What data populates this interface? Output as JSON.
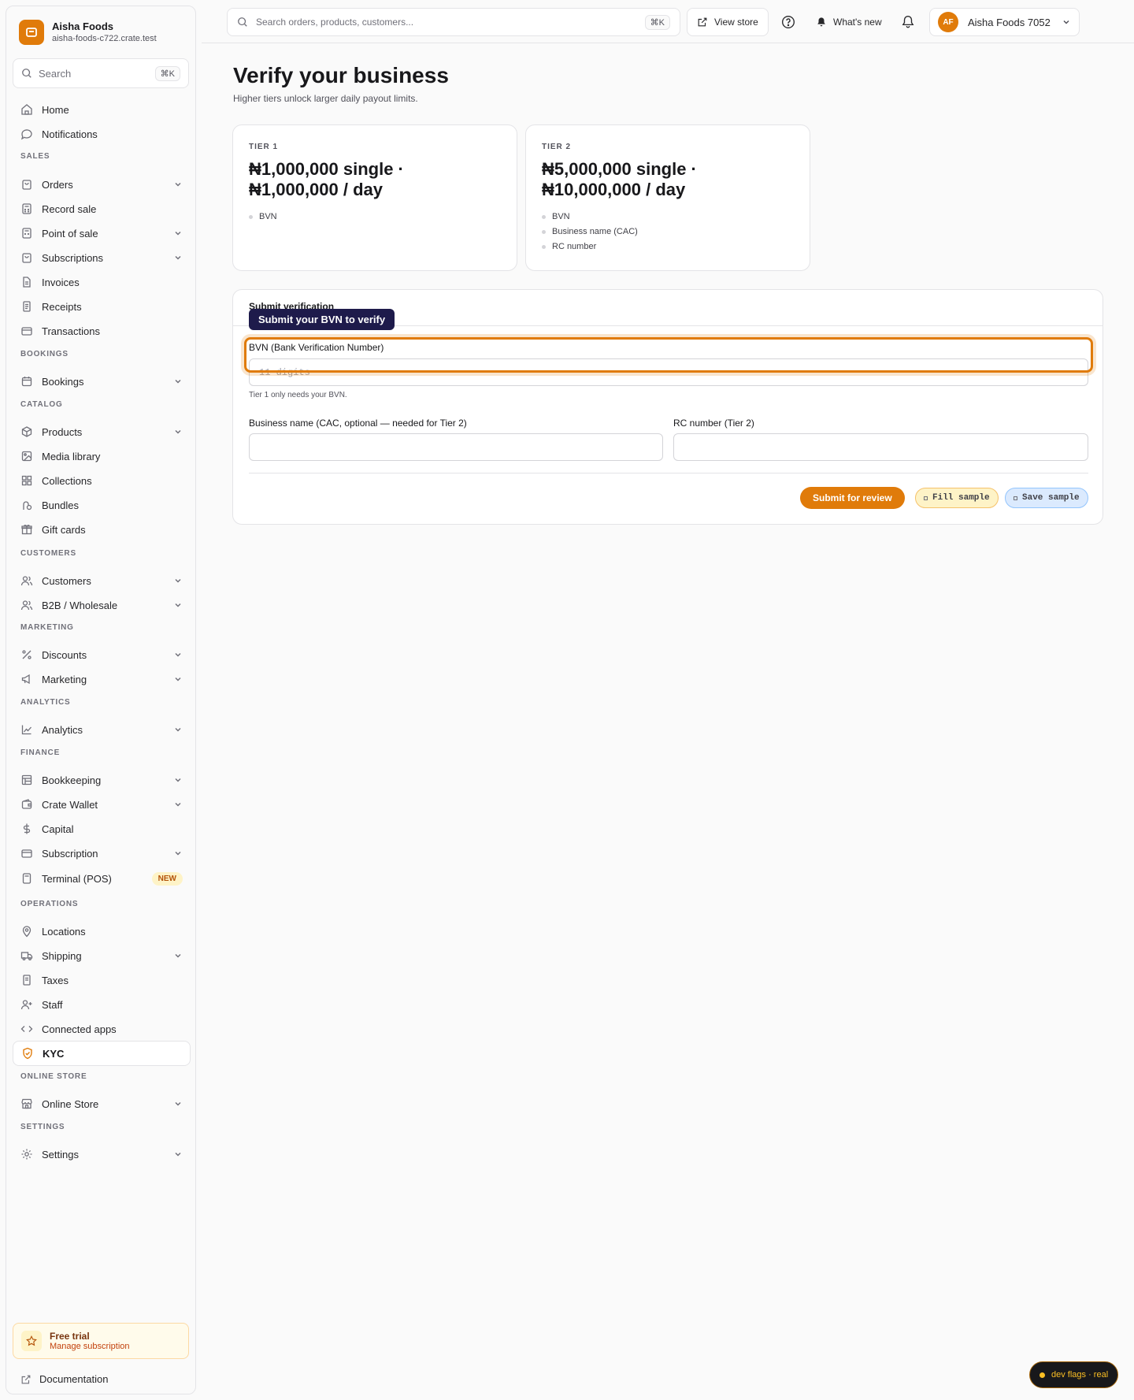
{
  "brand": {
    "name": "Aisha Foods",
    "domain": "aisha-foods-c722.crate.test"
  },
  "sidebar_search": {
    "label": "Search",
    "shortcut": "⌘K"
  },
  "nav": {
    "home": "Home",
    "notifications": "Notifications",
    "sales": {
      "heading": "SALES",
      "orders": "Orders",
      "record_sale": "Record sale",
      "pos": "Point of sale",
      "subscriptions": "Subscriptions",
      "invoices": "Invoices",
      "receipts": "Receipts",
      "transactions": "Transactions"
    },
    "bookings": {
      "heading": "BOOKINGS",
      "bookings": "Bookings"
    },
    "catalog": {
      "heading": "CATALOG",
      "products": "Products",
      "media": "Media library",
      "collections": "Collections",
      "bundles": "Bundles",
      "gift_cards": "Gift cards"
    },
    "customers": {
      "heading": "CUSTOMERS",
      "customers": "Customers",
      "b2b": "B2B / Wholesale"
    },
    "marketing": {
      "heading": "MARKETING",
      "discounts": "Discounts",
      "marketing": "Marketing"
    },
    "analytics": {
      "heading": "ANALYTICS",
      "analytics": "Analytics"
    },
    "finance": {
      "heading": "FINANCE",
      "bookkeeping": "Bookkeeping",
      "wallet": "Crate Wallet",
      "capital": "Capital",
      "subscription": "Subscription",
      "terminal": "Terminal (POS)",
      "terminal_badge": "NEW"
    },
    "operations": {
      "heading": "OPERATIONS",
      "locations": "Locations",
      "shipping": "Shipping",
      "taxes": "Taxes",
      "staff": "Staff",
      "apps": "Connected apps",
      "kyc": "KYC"
    },
    "online_store": {
      "heading": "ONLINE STORE",
      "online_store": "Online Store"
    },
    "settings": {
      "heading": "SETTINGS",
      "settings": "Settings"
    }
  },
  "trial": {
    "title": "Free trial",
    "link": "Manage subscription"
  },
  "docs": "Documentation",
  "topbar": {
    "search_placeholder": "Search orders, products, customers...",
    "search_shortcut": "⌘K",
    "view_store": "View store",
    "whats_new": "What's new",
    "account": {
      "initials": "AF",
      "name": "Aisha Foods 7052"
    }
  },
  "page": {
    "title": "Verify your business",
    "subtitle": "Higher tiers unlock larger daily payout limits."
  },
  "tiers": [
    {
      "label": "TIER 1",
      "line1": "₦1,000,000 single ·",
      "line2": "₦1,000,000 / day",
      "requirements": [
        "BVN"
      ]
    },
    {
      "label": "TIER 2",
      "line1": "₦5,000,000 single ·",
      "line2": "₦10,000,000 / day",
      "requirements": [
        "BVN",
        "Business name (CAC)",
        "RC number"
      ]
    }
  ],
  "form": {
    "heading": "Submit verification",
    "tooltip": "Submit your BVN to verify",
    "bvn_label": "BVN (Bank Verification Number)",
    "bvn_placeholder": "11 digits",
    "bvn_value": "",
    "bvn_hint": "Tier 1 only needs your BVN.",
    "business_label": "Business name (CAC, optional — needed for Tier 2)",
    "business_value": "",
    "rc_label": "RC number (Tier 2)",
    "rc_value": "",
    "submit": "Submit for review",
    "fill_sample": "Fill sample",
    "save_sample": "Save sample"
  },
  "devflags": "dev flags · real",
  "colors": {
    "accent": "#e07b0a",
    "tooltip_bg": "#1e1b4b"
  }
}
